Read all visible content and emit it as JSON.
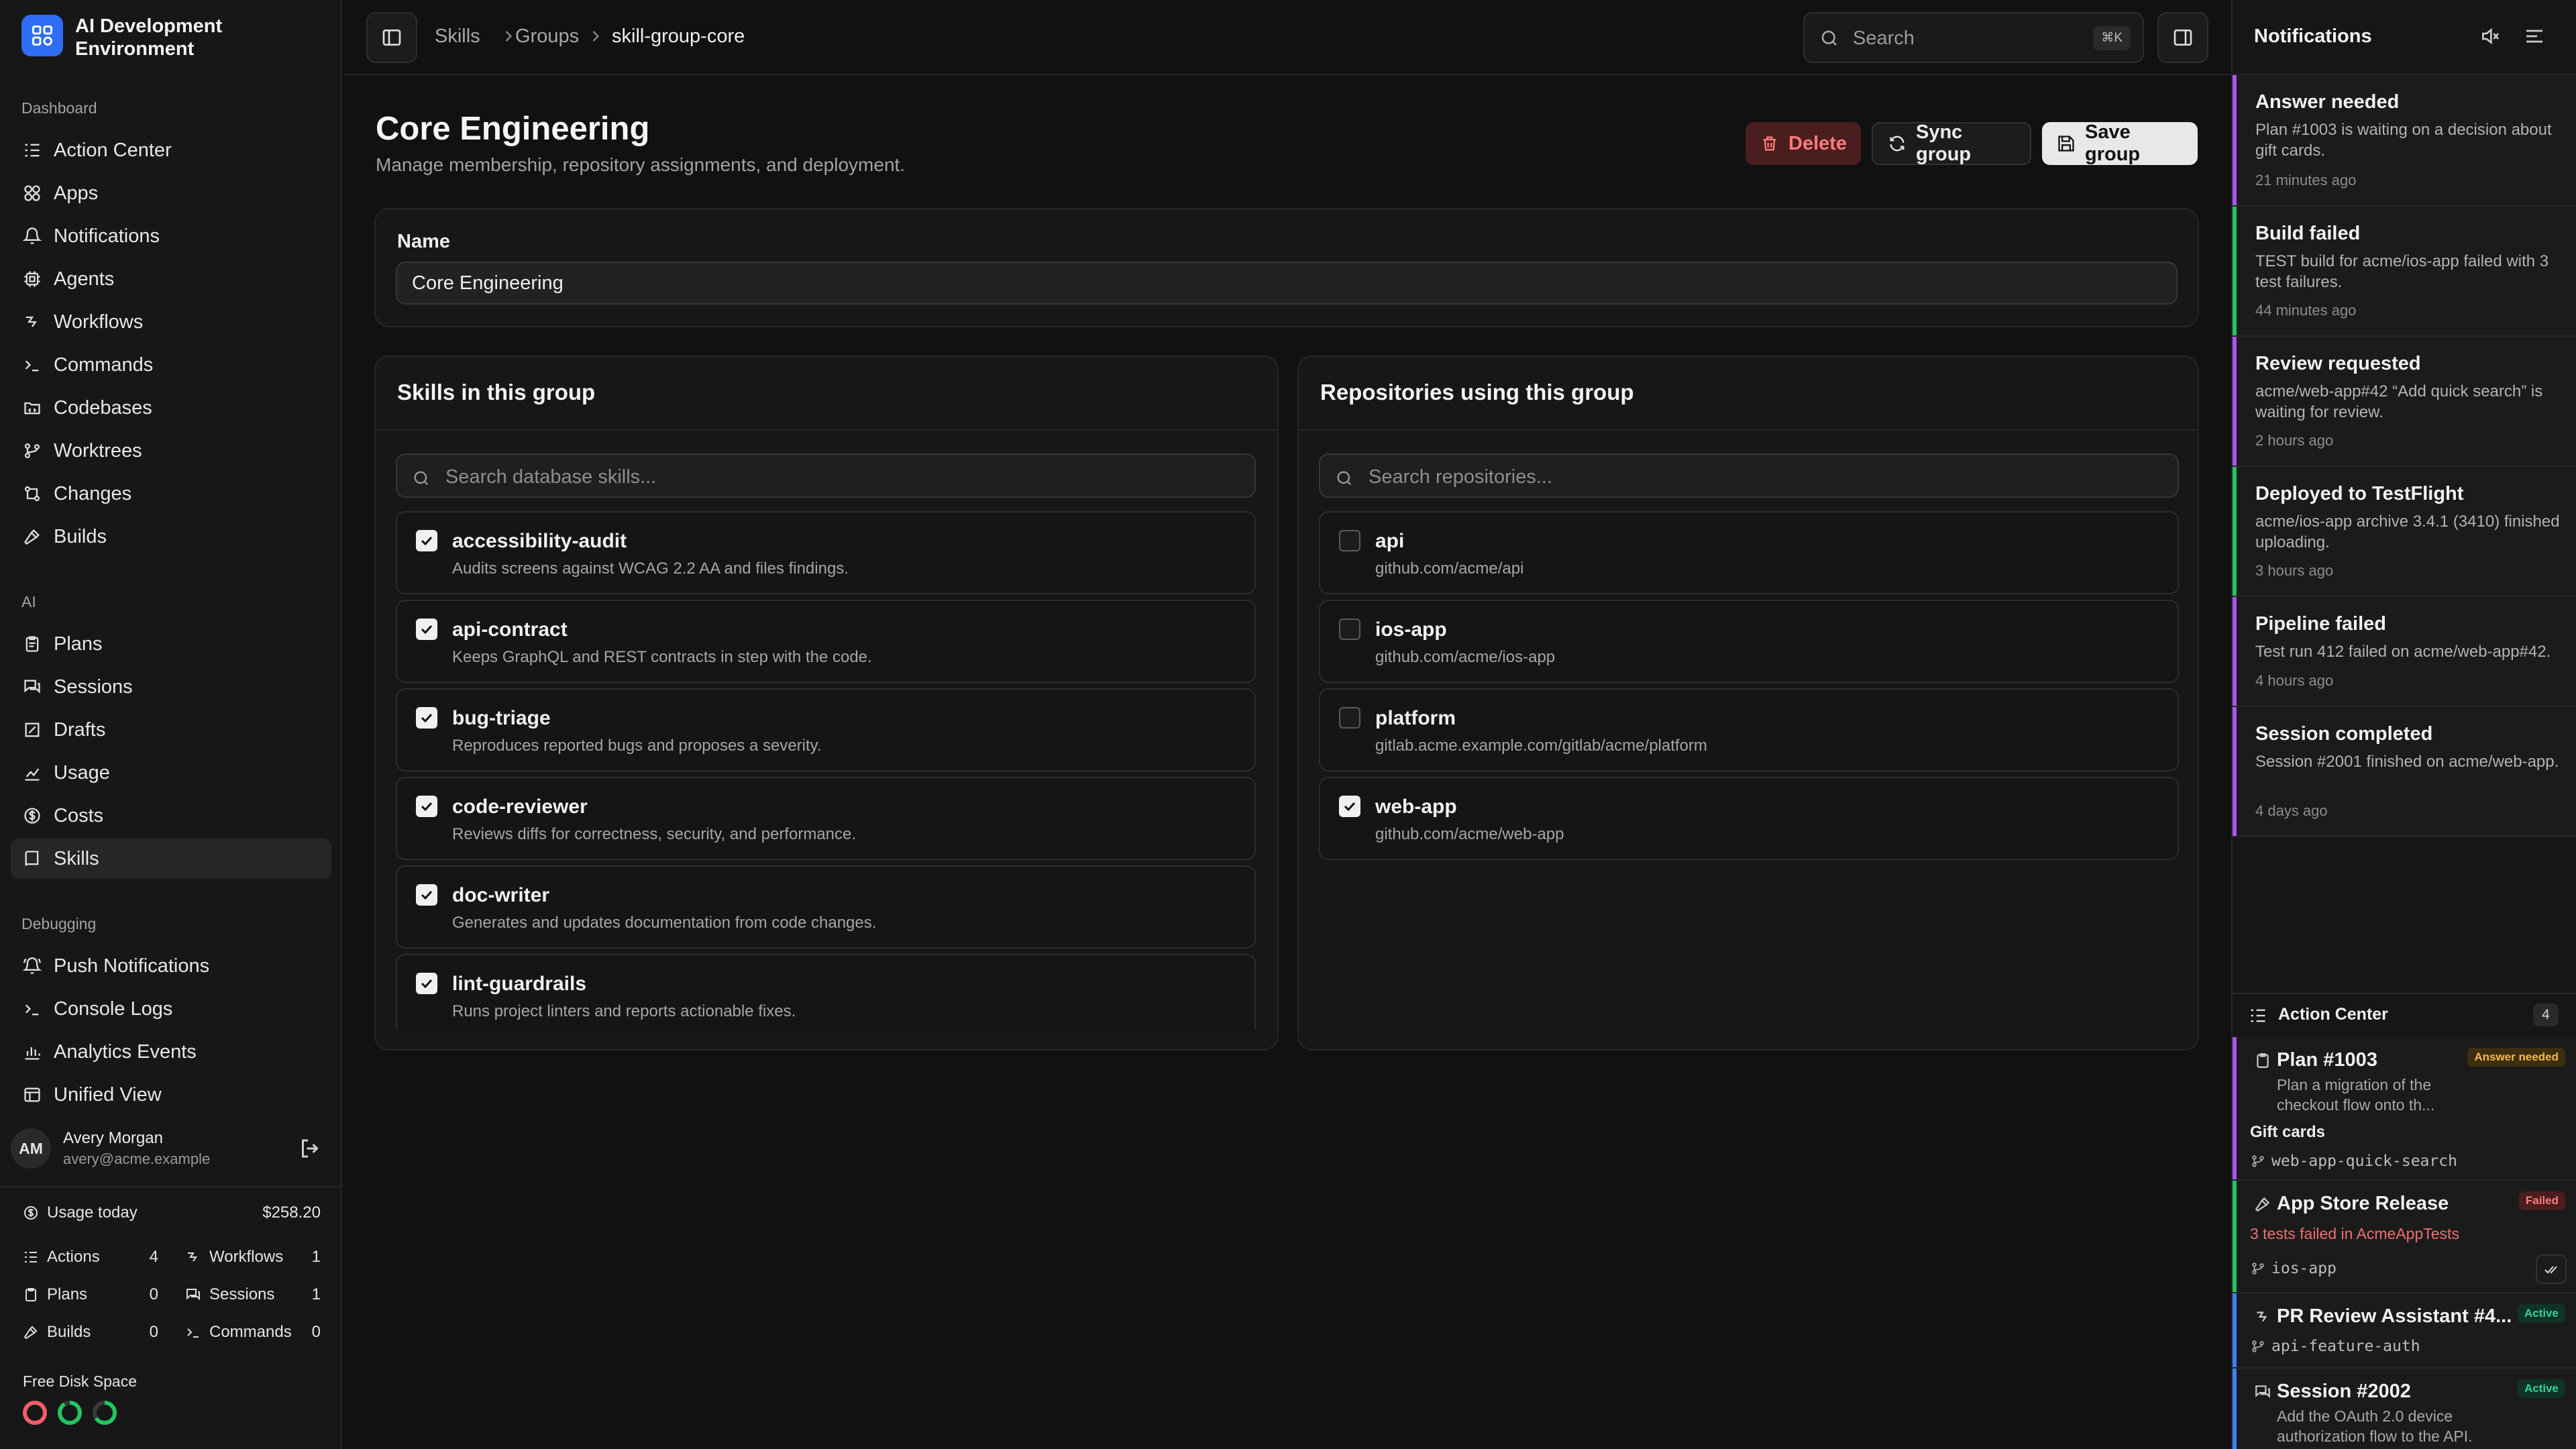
{
  "app": {
    "name": "AI Development Environment"
  },
  "sidebar": {
    "sections": [
      {
        "label": "Dashboard",
        "items": [
          {
            "label": "Action Center",
            "icon": "list-check-icon"
          },
          {
            "label": "Apps",
            "icon": "apps-icon"
          },
          {
            "label": "Notifications",
            "icon": "bell-icon"
          },
          {
            "label": "Agents",
            "icon": "cpu-icon"
          },
          {
            "label": "Workflows",
            "icon": "workflow-icon"
          },
          {
            "label": "Commands",
            "icon": "terminal-icon"
          },
          {
            "label": "Codebases",
            "icon": "folder-code-icon"
          },
          {
            "label": "Worktrees",
            "icon": "git-branch-icon"
          },
          {
            "label": "Changes",
            "icon": "git-compare-icon"
          },
          {
            "label": "Builds",
            "icon": "hammer-icon"
          }
        ]
      },
      {
        "label": "AI",
        "items": [
          {
            "label": "Plans",
            "icon": "clipboard-icon"
          },
          {
            "label": "Sessions",
            "icon": "chat-icon"
          },
          {
            "label": "Drafts",
            "icon": "draft-icon"
          },
          {
            "label": "Usage",
            "icon": "chart-icon"
          },
          {
            "label": "Costs",
            "icon": "dollar-circle-icon"
          },
          {
            "label": "Skills",
            "icon": "book-icon",
            "active": true
          }
        ]
      },
      {
        "label": "Debugging",
        "items": [
          {
            "label": "Push Notifications",
            "icon": "bell-ring-icon"
          },
          {
            "label": "Console Logs",
            "icon": "terminal-icon"
          },
          {
            "label": "Analytics Events",
            "icon": "analytics-icon"
          },
          {
            "label": "Unified View",
            "icon": "window-icon"
          }
        ]
      }
    ],
    "user": {
      "initials": "AM",
      "name": "Avery Morgan",
      "email": "avery@acme.example"
    },
    "usage": {
      "label": "Usage today",
      "amount": "$258.20",
      "stats": [
        {
          "label": "Actions",
          "value": "4"
        },
        {
          "label": "Workflows",
          "value": "1"
        },
        {
          "label": "Plans",
          "value": "0"
        },
        {
          "label": "Sessions",
          "value": "1"
        },
        {
          "label": "Builds",
          "value": "0"
        },
        {
          "label": "Commands",
          "value": "0"
        }
      ]
    },
    "disk": {
      "label": "Free Disk Space",
      "rings": [
        "#f25c6a",
        "#22c55e",
        "#22c55e"
      ]
    }
  },
  "topbar": {
    "breadcrumbs": [
      "Skills",
      "Groups",
      "skill-group-core"
    ],
    "search_placeholder": "Search",
    "search_shortcut": "⌘K"
  },
  "main": {
    "title": "Core Engineering",
    "subtitle": "Manage membership, repository assignments, and deployment.",
    "actions": {
      "delete": "Delete",
      "sync": "Sync group",
      "save": "Save group"
    },
    "name_label": "Name",
    "name_value": "Core Engineering",
    "skills_panel": {
      "title": "Skills in this group",
      "search_placeholder": "Search database skills...",
      "items": [
        {
          "name": "accessibility-audit",
          "desc": "Audits screens against WCAG 2.2 AA and files findings.",
          "checked": true
        },
        {
          "name": "api-contract",
          "desc": "Keeps GraphQL and REST contracts in step with the code.",
          "checked": true
        },
        {
          "name": "bug-triage",
          "desc": "Reproduces reported bugs and proposes a severity.",
          "checked": true
        },
        {
          "name": "code-reviewer",
          "desc": "Reviews diffs for correctness, security, and performance.",
          "checked": true
        },
        {
          "name": "doc-writer",
          "desc": "Generates and updates documentation from code changes.",
          "checked": true
        },
        {
          "name": "lint-guardrails",
          "desc": "Runs project linters and reports actionable fixes.",
          "checked": true
        }
      ]
    },
    "repos_panel": {
      "title": "Repositories using this group",
      "search_placeholder": "Search repositories...",
      "items": [
        {
          "name": "api",
          "desc": "github.com/acme/api",
          "checked": false
        },
        {
          "name": "ios-app",
          "desc": "github.com/acme/ios-app",
          "checked": false
        },
        {
          "name": "platform",
          "desc": "gitlab.acme.example.com/gitlab/acme/platform",
          "checked": false
        },
        {
          "name": "web-app",
          "desc": "github.com/acme/web-app",
          "checked": true
        }
      ]
    }
  },
  "notifications": {
    "title": "Notifications",
    "items": [
      {
        "title": "Answer needed",
        "body": "Plan #1003 is waiting on a decision about gift cards.",
        "time": "21 minutes ago",
        "color": "#a855f7"
      },
      {
        "title": "Build failed",
        "body": "TEST build for acme/ios-app failed with 3 test failures.",
        "time": "44 minutes ago",
        "color": "#22c55e"
      },
      {
        "title": "Review requested",
        "body": "acme/web-app#42 “Add quick search” is waiting for review.",
        "time": "2 hours ago",
        "color": "#a855f7"
      },
      {
        "title": "Deployed to TestFlight",
        "body": "acme/ios-app archive 3.4.1 (3410) finished uploading.",
        "time": "3 hours ago",
        "color": "#22c55e"
      },
      {
        "title": "Pipeline failed",
        "body": "Test run 412 failed on acme/web-app#42.",
        "time": "4 hours ago",
        "color": "#a855f7"
      },
      {
        "title": "Session completed",
        "body": "Session #2001 finished on acme/web-app.",
        "time": "4 days ago",
        "color": "#a855f7"
      }
    ]
  },
  "action_center": {
    "title": "Action Center",
    "count": "4",
    "items": [
      {
        "title": "Plan #1003",
        "badge": "Answer needed",
        "body": "Plan a migration of the checkout flow onto th...",
        "extra": "Gift cards",
        "branch": "web-app-quick-search",
        "color": "#a855f7"
      },
      {
        "title": "App Store Release",
        "badge": "Failed",
        "body": "3 tests failed in AcmeAppTests",
        "branch": "ios-app",
        "color": "#22c55e"
      },
      {
        "title": "PR Review Assistant #4...",
        "badge": "Active",
        "branch": "api-feature-auth",
        "color": "#3b82f6"
      },
      {
        "title": "Session #2002",
        "badge": "Active",
        "body": "Add the OAuth 2.0 device authorization flow to the API.",
        "color": "#3b82f6"
      }
    ]
  }
}
